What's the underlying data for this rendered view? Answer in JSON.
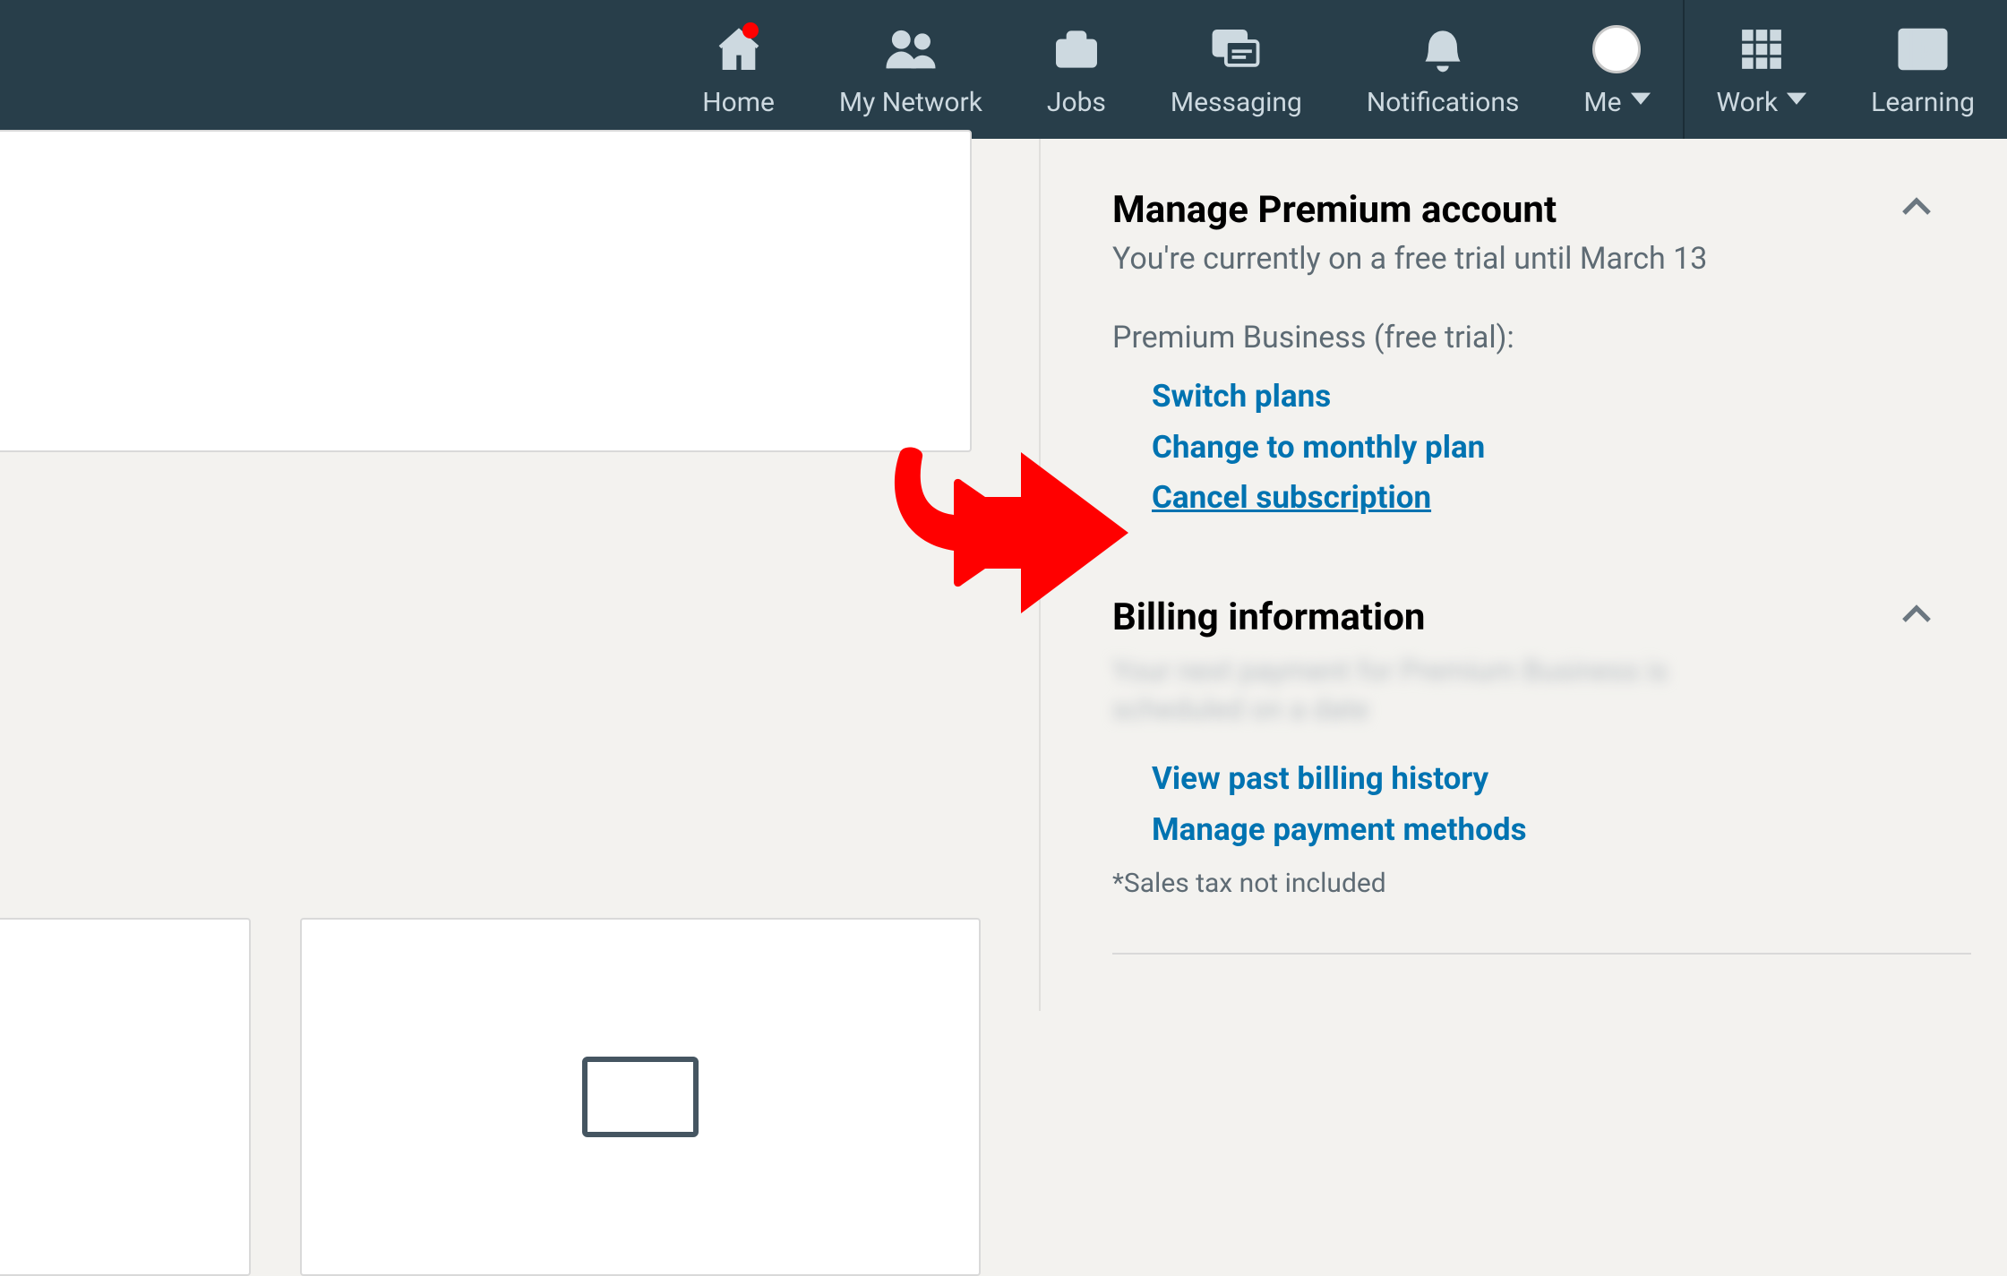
{
  "nav": {
    "items": [
      {
        "id": "home",
        "label": "Home"
      },
      {
        "id": "network",
        "label": "My Network"
      },
      {
        "id": "jobs",
        "label": "Jobs"
      },
      {
        "id": "messaging",
        "label": "Messaging"
      },
      {
        "id": "notifications",
        "label": "Notifications"
      },
      {
        "id": "me",
        "label": "Me"
      },
      {
        "id": "work",
        "label": "Work"
      },
      {
        "id": "learning",
        "label": "Learning"
      }
    ],
    "home_has_badge": true
  },
  "premium": {
    "title": "Manage Premium account",
    "subtitle": "You're currently on a free trial until March 13",
    "plan_label": "Premium Business (free trial):",
    "links": [
      {
        "id": "switch",
        "label": "Switch plans"
      },
      {
        "id": "monthly",
        "label": "Change to monthly plan"
      },
      {
        "id": "cancel",
        "label": "Cancel subscription"
      }
    ]
  },
  "billing": {
    "title": "Billing information",
    "redacted_placeholder": "Your next payment for Premium Business is scheduled on a date",
    "links": [
      {
        "id": "history",
        "label": "View past billing history"
      },
      {
        "id": "payment",
        "label": "Manage payment methods"
      }
    ],
    "note": "*Sales tax not included"
  }
}
